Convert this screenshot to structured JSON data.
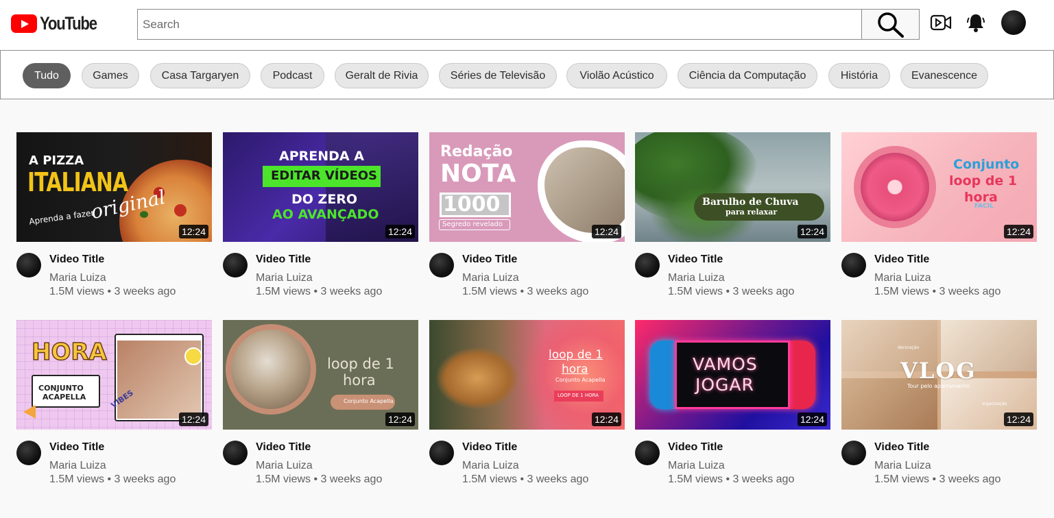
{
  "header": {
    "logo_text": "YouTube",
    "search_placeholder": "Search",
    "icons": [
      "search-icon",
      "create-video-icon",
      "notifications-bell-icon",
      "account-avatar"
    ]
  },
  "chips": [
    {
      "label": "Tudo",
      "active": true
    },
    {
      "label": "Games"
    },
    {
      "label": "Casa Targaryen"
    },
    {
      "label": "Podcast"
    },
    {
      "label": "Geralt de Rivia"
    },
    {
      "label": "Séries de Televisão"
    },
    {
      "label": "Violão Acústico"
    },
    {
      "label": "Ciência da Computação"
    },
    {
      "label": "História"
    },
    {
      "label": "Evanescence"
    }
  ],
  "videos": [
    {
      "title": "Video Title",
      "channel": "Maria Luiza",
      "meta": "1.5M views • 3 weeks ago",
      "duration": "12:24",
      "thumb": {
        "line1": "A PIZZA",
        "line2": "ITALIANA",
        "line3": "original",
        "line4": "Aprenda a fazer"
      }
    },
    {
      "title": "Video Title",
      "channel": "Maria Luiza",
      "meta": "1.5M views • 3 weeks ago",
      "duration": "12:24",
      "thumb": {
        "line1": "APRENDA A",
        "line2": "EDITAR VÍDEOS",
        "line3": "DO ZERO",
        "line4": "AO AVANÇADO"
      }
    },
    {
      "title": "Video Title",
      "channel": "Maria Luiza",
      "meta": "1.5M views • 3 weeks ago",
      "duration": "12:24",
      "thumb": {
        "line1": "Redação",
        "line2": "NOTA",
        "line3": "1000",
        "line4": "Segredo revelado"
      }
    },
    {
      "title": "Video Title",
      "channel": "Maria Luiza",
      "meta": "1.5M views • 3 weeks ago",
      "duration": "12:24",
      "thumb": {
        "line1": "Barulho de Chuva",
        "line2": "para relaxar"
      }
    },
    {
      "title": "Video Title",
      "channel": "Maria Luiza",
      "meta": "1.5M views • 3 weeks ago",
      "duration": "12:24",
      "thumb": {
        "line1": "Conjunto",
        "line2": "loop de 1",
        "line3": "hora",
        "line4": "FACIL"
      }
    },
    {
      "title": "Video Title",
      "channel": "Maria Luiza",
      "meta": "1.5M views • 3 weeks ago",
      "duration": "12:24",
      "thumb": {
        "line1": "HORA",
        "line2": "CONJUNTO",
        "line3": "ACAPELLA",
        "line4": "VIBES"
      }
    },
    {
      "title": "Video Title",
      "channel": "Maria Luiza",
      "meta": "1.5M views • 3 weeks ago",
      "duration": "12:24",
      "thumb": {
        "line1": "loop de 1",
        "line2": "hora",
        "line3": "Conjunto Acapella"
      }
    },
    {
      "title": "Video Title",
      "channel": "Maria Luiza",
      "meta": "1.5M views • 3 weeks ago",
      "duration": "12:24",
      "thumb": {
        "line1": "loop de 1",
        "line2": "hora",
        "line3": "Conjunto Acapella",
        "line4": "LOOP DE 1 HORA"
      }
    },
    {
      "title": "Video Title",
      "channel": "Maria Luiza",
      "meta": "1.5M views • 3 weeks ago",
      "duration": "12:24",
      "thumb": {
        "line1": "VAMOS",
        "line2": "JOGAR"
      }
    },
    {
      "title": "Video Title",
      "channel": "Maria Luiza",
      "meta": "1.5M views • 3 weeks ago",
      "duration": "12:24",
      "thumb": {
        "line1": "VLOG",
        "line2": "Tour pelo apartamento",
        "line3": "decoração",
        "line4": "organização"
      }
    }
  ]
}
